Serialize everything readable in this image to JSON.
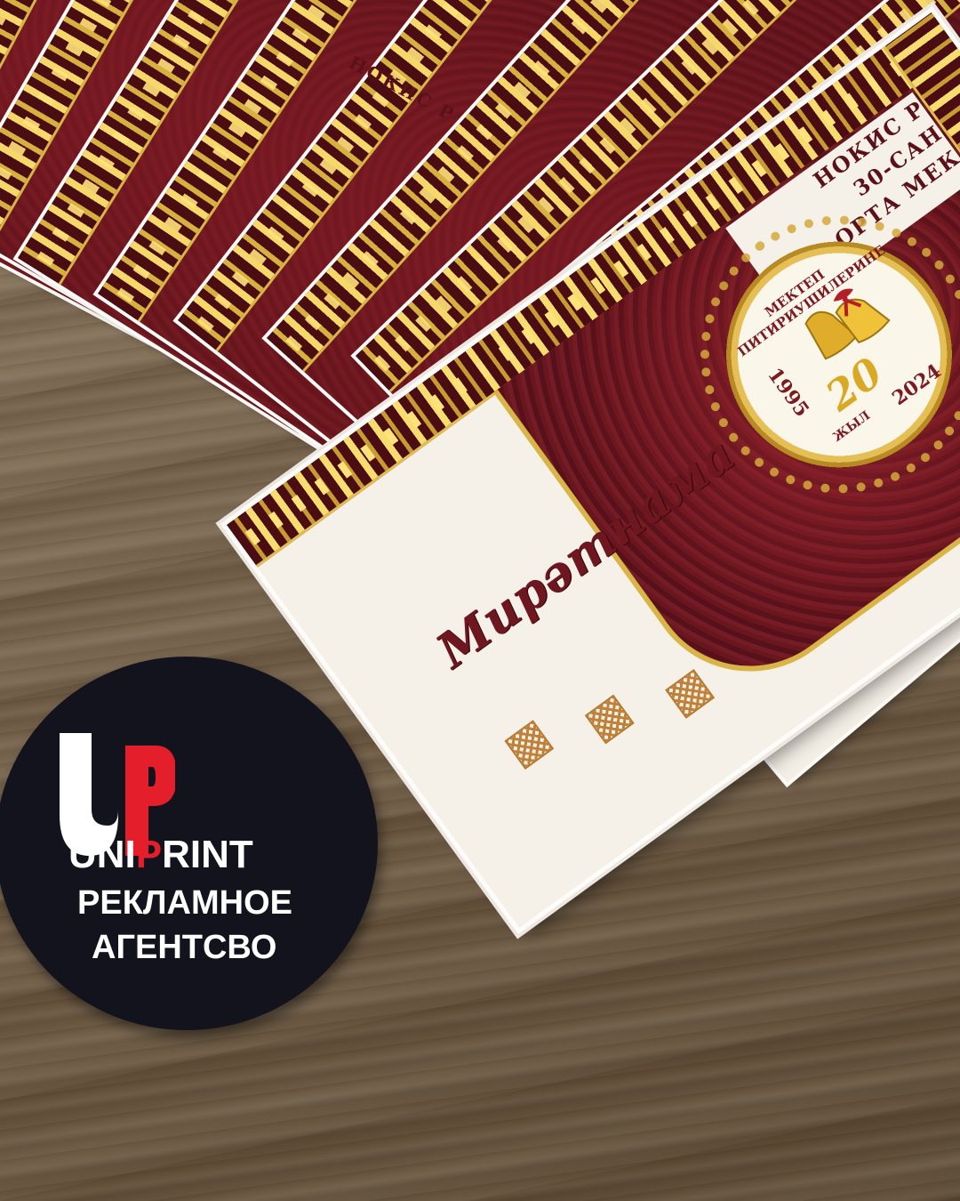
{
  "booklet": {
    "header_lines": [
      "НОКИС Р",
      "30-САН",
      "ОРТА МЕК"
    ],
    "back_header": "НОКИС Р",
    "title": "Мирәтнама",
    "emblem": {
      "top_text": "МЕКТЕП ПИТИРИУШИЛЕРИНЕ",
      "year_start": "1995",
      "year_end": "2024",
      "number": "20",
      "unit": "ЖЫЛ"
    },
    "colors": {
      "maroon": "#5c1219",
      "gold": "#d9b446",
      "paper": "#f6f1e8"
    }
  },
  "sticker": {
    "logo_letters": "UP",
    "brand_white": "UNI",
    "brand_red": "P",
    "brand_tail": "RINT",
    "line2": "РЕКЛАМНОЕ",
    "line3": "АГЕНТСВО",
    "colors": {
      "background": "#12131c",
      "accent": "#e41f2b",
      "text": "#ffffff"
    }
  }
}
